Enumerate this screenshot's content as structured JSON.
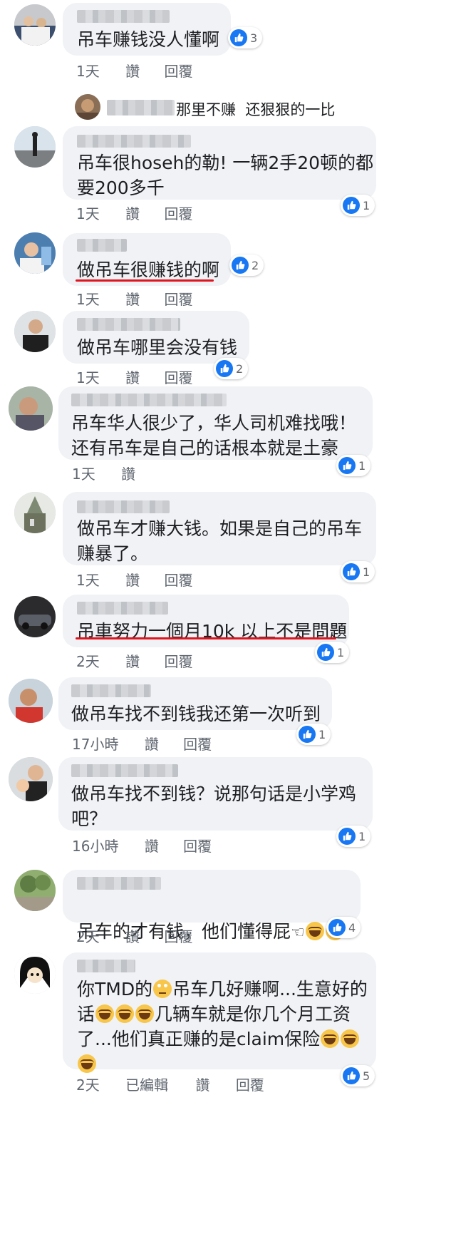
{
  "icons": {
    "like": "thumbs-up-icon",
    "laugh": "laughing-emoji-icon",
    "roll": "eye-roll-emoji-icon",
    "finger": "pointing-finger-icon"
  },
  "colors": {
    "like_blue": "#1877f2",
    "bubble": "#f0f2f5",
    "underline_red": "#e0141e",
    "meta_grey": "#606770"
  },
  "comments": [
    {
      "text": "吊车赚钱没人懂啊",
      "time": "1天",
      "like": "讚",
      "reply": "回覆",
      "reactions": "3"
    },
    {
      "reply_line_text": "那里不赚  还狠狠的一比"
    },
    {
      "text": "吊车很hoseh的勒! 一辆2手20顿的都\n要200多千",
      "time": "1天",
      "like": "讚",
      "reply": "回覆",
      "reactions": "1"
    },
    {
      "text": "做吊车很赚钱的啊",
      "time": "1天",
      "like": "讚",
      "reply": "回覆",
      "reactions": "2"
    },
    {
      "text": "做吊车哪里会没有钱",
      "time": "1天",
      "like": "讚",
      "reply": "回覆",
      "reactions": "2"
    },
    {
      "text": "吊车华人很少了，华人司机难找哦！\n还有吊车是自己的话根本就是土豪",
      "time": "1天",
      "like": "讚",
      "reactions": "1"
    },
    {
      "text": "做吊车才赚大钱。如果是自己的吊车\n赚暴了。",
      "time": "1天",
      "like": "讚",
      "reply": "回覆",
      "reactions": "1"
    },
    {
      "text": "吊車努力一個月10k 以上不是問題",
      "time": "2天",
      "like": "讚",
      "reply": "回覆",
      "reactions": "1"
    },
    {
      "text": "做吊车找不到钱我还第一次听到",
      "time": "17小時",
      "like": "讚",
      "reply": "回覆",
      "reactions": "1"
    },
    {
      "text": "做吊车找不到钱？说那句话是小学鸡\n吧？",
      "time": "16小時",
      "like": "讚",
      "reply": "回覆",
      "reactions": "1"
    },
    {
      "text": "吊车的才有钱，他们懂得屁",
      "time": "2天",
      "like": "讚",
      "reply": "回覆",
      "reactions": "4"
    },
    {
      "text_part1": "你TMD的",
      "text_part2": "吊车几好赚啊...生意好的",
      "text_part3": "话",
      "text_part4": "几辆车就是你几个月工资",
      "text_part5": "了...他们真正赚的是claim保险",
      "time": "2天",
      "edited": "已編輯",
      "like": "讚",
      "reply": "回覆",
      "reactions": "5"
    }
  ]
}
